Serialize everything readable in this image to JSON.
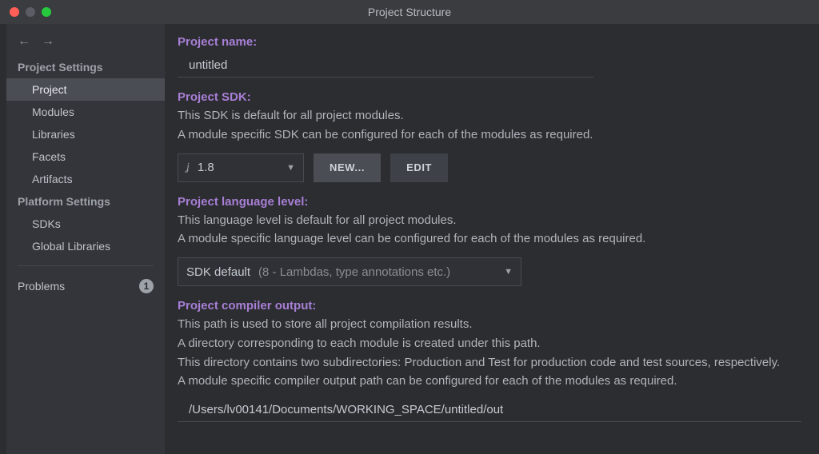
{
  "window": {
    "title": "Project Structure"
  },
  "sidebar": {
    "sections": [
      {
        "header": "Project Settings",
        "items": [
          {
            "label": "Project",
            "selected": true
          },
          {
            "label": "Modules"
          },
          {
            "label": "Libraries"
          },
          {
            "label": "Facets"
          },
          {
            "label": "Artifacts"
          }
        ]
      },
      {
        "header": "Platform Settings",
        "items": [
          {
            "label": "SDKs"
          },
          {
            "label": "Global Libraries"
          }
        ]
      }
    ],
    "problems": {
      "label": "Problems",
      "count": "1"
    }
  },
  "main": {
    "project_name": {
      "label": "Project name:",
      "value": "untitled"
    },
    "sdk": {
      "label": "Project SDK:",
      "desc1": "This SDK is default for all project modules.",
      "desc2": "A module specific SDK can be configured for each of the modules as required.",
      "selected": "1.8",
      "new_btn": "NEW...",
      "edit_btn": "EDIT"
    },
    "lang_level": {
      "label": "Project language level:",
      "desc1": "This language level is default for all project modules.",
      "desc2": "A module specific language level can be configured for each of the modules as required.",
      "selected_prefix": "SDK default ",
      "selected_detail": "(8 - Lambdas, type annotations etc.)"
    },
    "compiler_out": {
      "label": "Project compiler output:",
      "desc1": "This path is used to store all project compilation results.",
      "desc2": "A directory corresponding to each module is created under this path.",
      "desc3": "This directory contains two subdirectories: Production and Test for production code and test sources, respectively.",
      "desc4": "A module specific compiler output path can be configured for each of the modules as required.",
      "value": "/Users/lv00141/Documents/WORKING_SPACE/untitled/out"
    }
  }
}
